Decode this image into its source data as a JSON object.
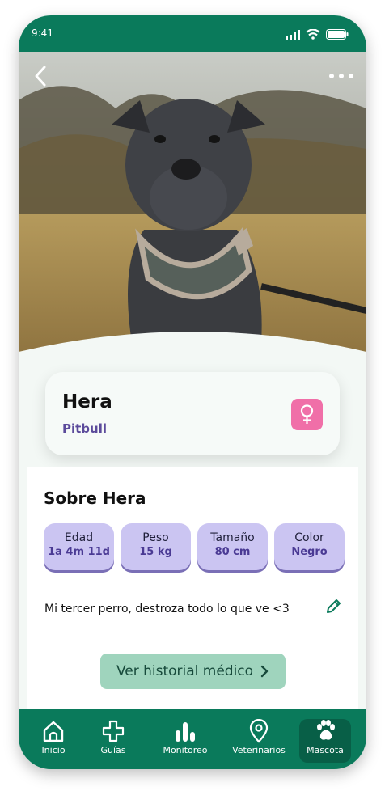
{
  "status_bar": {
    "time": "9:41"
  },
  "pet": {
    "name": "Hera",
    "breed": "Pitbull",
    "sex_icon": "female-symbol-icon"
  },
  "about": {
    "title": "Sobre Hera",
    "stats": [
      {
        "label": "Edad",
        "value": "1a 4m 11d"
      },
      {
        "label": "Peso",
        "value": "15 kg"
      },
      {
        "label": "Tamaño",
        "value": "80 cm"
      },
      {
        "label": "Color",
        "value": "Negro"
      }
    ],
    "note": "Mi tercer perro, destroza todo lo que ve <3",
    "history_button": "Ver historial médico"
  },
  "tabs": [
    {
      "label": "Inicio",
      "icon": "home-icon"
    },
    {
      "label": "Guías",
      "icon": "plus-icon"
    },
    {
      "label": "Monitoreo",
      "icon": "bar-chart-icon"
    },
    {
      "label": "Veterinarios",
      "icon": "location-pin-icon"
    },
    {
      "label": "Mascota",
      "icon": "paw-icon",
      "active": true
    }
  ],
  "colors": {
    "primary": "#0a7a5b",
    "badge": "#f06fa8",
    "stat_bg": "#cbc5f2",
    "accent_text": "#5b4a9b",
    "cta_bg": "#9fd4bd"
  }
}
